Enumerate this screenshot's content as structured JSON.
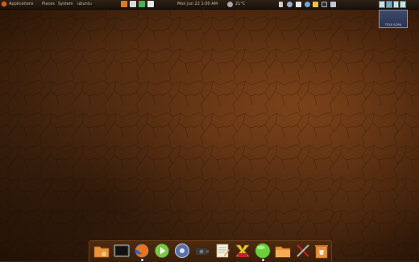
{
  "top_panel": {
    "menus": [
      "Applications",
      "Places",
      "System",
      "ubuntu"
    ],
    "clock": "Mon Jun 22  1:00 AM",
    "weather": "21°C"
  },
  "workspace_switcher": {
    "workspaces": 4,
    "active_index": 1,
    "preview_label": "TITLE SCRN"
  },
  "dock": {
    "items": [
      {
        "name": "home-folder",
        "icon": "home-folder-icon",
        "running": false
      },
      {
        "name": "terminal",
        "icon": "terminal-icon",
        "running": false
      },
      {
        "name": "firefox",
        "icon": "firefox-icon",
        "running": true
      },
      {
        "name": "media-player",
        "icon": "play-icon",
        "running": false
      },
      {
        "name": "system-settings",
        "icon": "gear-icon",
        "running": false
      },
      {
        "name": "screenshot",
        "icon": "camera-icon",
        "running": false
      },
      {
        "name": "text-editor",
        "icon": "notepad-icon",
        "running": false
      },
      {
        "name": "xchat",
        "icon": "x-chat-icon",
        "running": false
      },
      {
        "name": "status-green",
        "icon": "green-circle-icon",
        "running": true
      },
      {
        "name": "documents-folder",
        "icon": "folder-icon",
        "running": false
      },
      {
        "name": "system-tools",
        "icon": "tools-icon",
        "running": false
      },
      {
        "name": "trash",
        "icon": "trash-icon",
        "running": false
      }
    ]
  },
  "colors": {
    "panel": "#1f160e",
    "desktop": "#5a3214",
    "dock": "#42230b"
  }
}
